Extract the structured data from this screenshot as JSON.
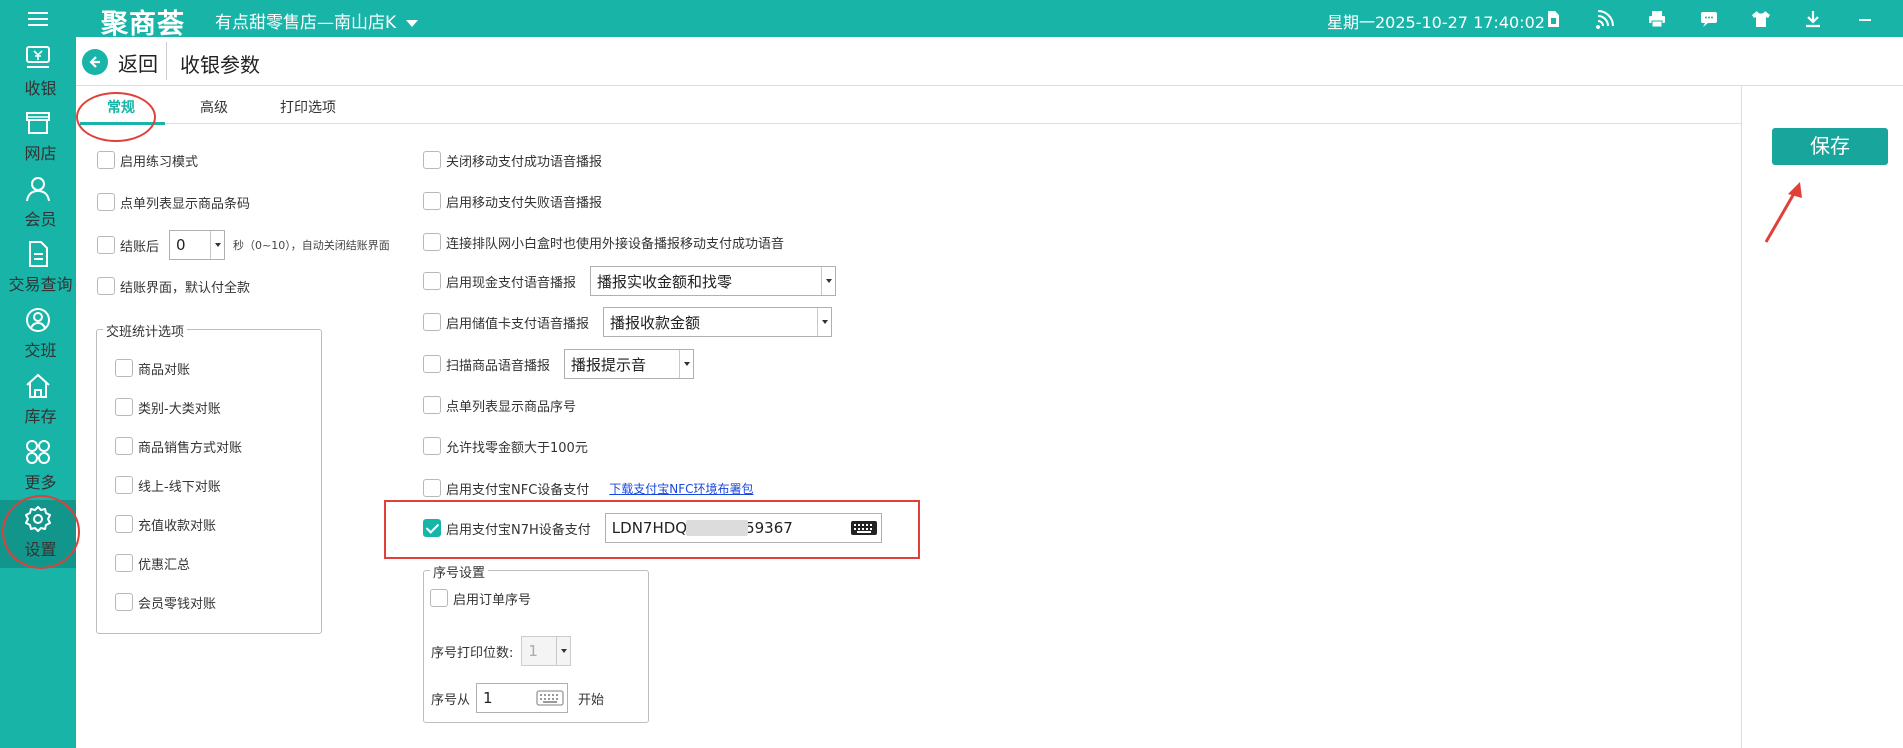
{
  "topbar": {
    "logo": "聚商荟",
    "store": "有点甜零售店—南山店K",
    "datetime": "星期一2025-10-27 17:40:02",
    "icons": [
      "sim-card-icon",
      "wifi-signal-icon",
      "printer-icon",
      "message-icon",
      "shirt-icon",
      "download-icon",
      "minimize-icon"
    ]
  },
  "sidebar": {
    "items": [
      {
        "label": "收银",
        "icon": "cashier-icon"
      },
      {
        "label": "网店",
        "icon": "store-icon"
      },
      {
        "label": "会员",
        "icon": "member-icon"
      },
      {
        "label": "交易查询",
        "icon": "document-icon"
      },
      {
        "label": "交班",
        "icon": "shift-icon"
      },
      {
        "label": "库存",
        "icon": "house-icon"
      },
      {
        "label": "更多",
        "icon": "more-grid-icon"
      },
      {
        "label": "设置",
        "icon": "gear-icon"
      }
    ]
  },
  "header": {
    "back": "返回",
    "title": "收银参数"
  },
  "tabs": [
    "常规",
    "高级",
    "打印选项"
  ],
  "left": {
    "practice_mode": "启用练习模式",
    "show_barcode": "点单列表显示商品条码",
    "after_checkout_prefix": "结账后",
    "after_checkout_value": "0",
    "after_checkout_suffix": "秒（0~10），自动关闭结账界面",
    "default_full_pay": "结账界面，默认付全款",
    "shift_group": {
      "title": "交班统计选项",
      "items": [
        "商品对账",
        "类别-大类对账",
        "商品销售方式对账",
        "线上-线下对账",
        "充值收款对账",
        "优惠汇总",
        "会员零钱对账"
      ]
    }
  },
  "right": {
    "close_voice_success": "关闭移动支付成功语音播报",
    "enable_voice_fail": "启用移动支付失败语音播报",
    "queue_box_voice": "连接排队网小白盒时也使用外接设备播报移动支付成功语音",
    "cash_voice": "启用现金支付语音播报",
    "cash_voice_option": "播报实收金额和找零",
    "stored_card_voice": "启用储值卡支付语音播报",
    "stored_card_option": "播报收款金额",
    "scan_voice": "扫描商品语音播报",
    "scan_option": "播报提示音",
    "show_seq": "点单列表显示商品序号",
    "change_over_100": "允许找零金额大于100元",
    "alipay_nfc": "启用支付宝NFC设备支付",
    "alipay_nfc_link": "下载支付宝NFC环境布署包",
    "alipay_n7h": "启用支付宝N7H设备支付",
    "device_sn_head": "LDN7HDQ",
    "device_sn_tail": "59367",
    "seq_group": {
      "title": "序号设置",
      "enable_order_seq": "启用订单序号",
      "digits_label": "序号打印位数:",
      "digits_value": "1",
      "from_label": "序号从",
      "from_value": "1",
      "from_suffix": "开始"
    }
  },
  "save_label": "保存",
  "colors": {
    "brand": "#18b4a8",
    "annotation": "#e0403a",
    "link": "#1a47e0"
  }
}
